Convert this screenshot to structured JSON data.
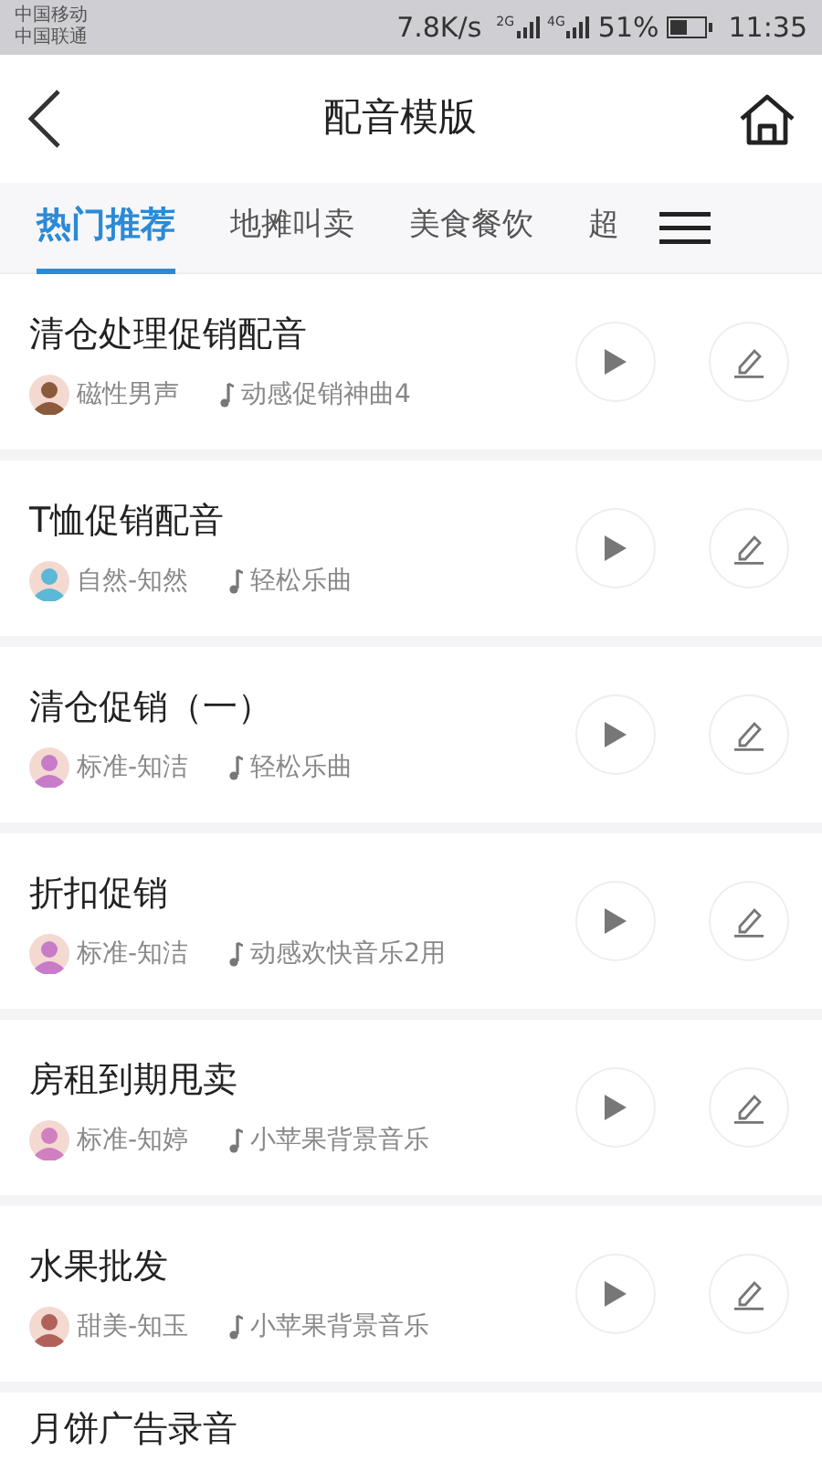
{
  "status_bar": {
    "carriers": [
      "中国移动",
      "中国联通"
    ],
    "speed": "7.8K/s",
    "networks": [
      "2G",
      "4G"
    ],
    "battery": "51%",
    "time": "11:35"
  },
  "header": {
    "title": "配音模版"
  },
  "tabs": [
    {
      "label": "热门推荐",
      "selected": true
    },
    {
      "label": "地摊叫卖",
      "selected": false
    },
    {
      "label": "美食餐饮",
      "selected": false
    },
    {
      "label": "超",
      "selected": false
    }
  ],
  "items": [
    {
      "title": "清仓处理促销配音",
      "voice": "磁性男声",
      "music": "动感促销神曲4",
      "color": "#8a5a3c"
    },
    {
      "title": "T恤促销配音",
      "voice": "自然-知然",
      "music": "轻松乐曲",
      "color": "#5bb8d6"
    },
    {
      "title": "清仓促销（一）",
      "voice": "标准-知洁",
      "music": "轻松乐曲",
      "color": "#c77bc9"
    },
    {
      "title": "折扣促销",
      "voice": "标准-知洁",
      "music": "动感欢快音乐2用",
      "color": "#c77bc9"
    },
    {
      "title": "房租到期甩卖",
      "voice": "标准-知婷",
      "music": "小苹果背景音乐",
      "color": "#d07fc0"
    },
    {
      "title": "水果批发",
      "voice": "甜美-知玉",
      "music": "小苹果背景音乐",
      "color": "#b0625a"
    },
    {
      "title": "月饼广告录音"
    }
  ]
}
